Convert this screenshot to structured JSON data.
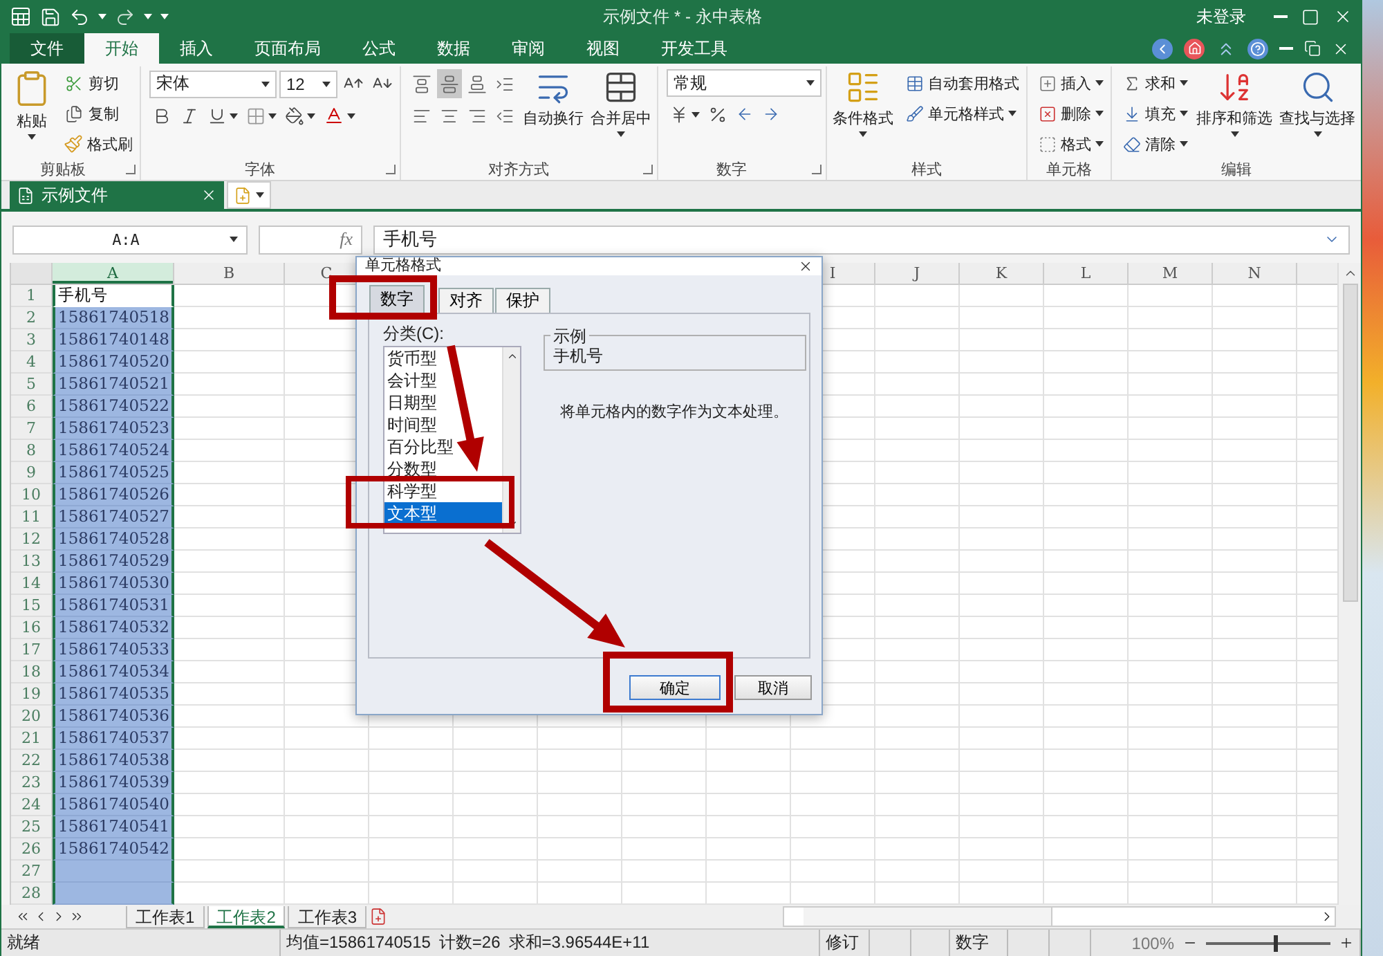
{
  "window": {
    "title": "示例文件 * - 永中表格",
    "user": "未登录"
  },
  "menu_tabs": [
    {
      "label": "文件",
      "kind": "file",
      "selected": false
    },
    {
      "label": "开始",
      "kind": "tab",
      "selected": true
    },
    {
      "label": "插入",
      "kind": "tab",
      "selected": false
    },
    {
      "label": "页面布局",
      "kind": "tab",
      "selected": false
    },
    {
      "label": "公式",
      "kind": "tab",
      "selected": false
    },
    {
      "label": "数据",
      "kind": "tab",
      "selected": false
    },
    {
      "label": "审阅",
      "kind": "tab",
      "selected": false
    },
    {
      "label": "视图",
      "kind": "tab",
      "selected": false
    },
    {
      "label": "开发工具",
      "kind": "tab",
      "selected": false
    }
  ],
  "ribbon": {
    "clipboard": {
      "paste": "粘贴",
      "cut": "剪切",
      "copy": "复制",
      "painter": "格式刷",
      "label": "剪贴板"
    },
    "font": {
      "name": "宋体",
      "size": "12",
      "label": "字体"
    },
    "alignment": {
      "buttons": [
        {
          "selected": false
        },
        {
          "selected": true
        },
        {
          "selected": false
        },
        {
          "selected": false
        },
        {
          "selected": false
        },
        {
          "selected": false
        },
        {
          "selected": false
        },
        {
          "selected": false
        }
      ],
      "wrap": "自动换行",
      "merge": "合并居中",
      "label": "对齐方式"
    },
    "number": {
      "format": "常规",
      "label": "数字"
    },
    "styles": {
      "conditional": "条件格式",
      "auto": "自动套用格式",
      "cell_styles": "单元格样式",
      "label": "样式"
    },
    "cells": {
      "insert": "插入",
      "delete": "删除",
      "format": "格式",
      "label": "单元格"
    },
    "editing": {
      "sum": "求和",
      "fill": "填充",
      "clear": "清除",
      "sort": "排序和筛选",
      "find": "查找与选择",
      "label": "编辑"
    }
  },
  "document_tab": {
    "title": "示例文件"
  },
  "formula_bar": {
    "name_box": "A:A",
    "fx": "fx",
    "content": "手机号"
  },
  "sheet": {
    "columns": [
      {
        "label": "A",
        "selected": true
      },
      {
        "label": "B",
        "selected": false
      },
      {
        "label": "C",
        "selected": false
      },
      {
        "label": "I",
        "selected": false
      },
      {
        "label": "J",
        "selected": false
      },
      {
        "label": "K",
        "selected": false
      },
      {
        "label": "L",
        "selected": false
      },
      {
        "label": "M",
        "selected": false
      },
      {
        "label": "N",
        "selected": false
      }
    ],
    "rows": [
      {
        "number": "1",
        "a": "手机号",
        "kind": "text",
        "active": true
      },
      {
        "number": "2",
        "a": "15861740518",
        "kind": "number",
        "active": false
      },
      {
        "number": "3",
        "a": "15861740148",
        "kind": "number",
        "active": false
      },
      {
        "number": "4",
        "a": "15861740520",
        "kind": "number",
        "active": false
      },
      {
        "number": "5",
        "a": "15861740521",
        "kind": "number",
        "active": false
      },
      {
        "number": "6",
        "a": "15861740522",
        "kind": "number",
        "active": false
      },
      {
        "number": "7",
        "a": "15861740523",
        "kind": "number",
        "active": false
      },
      {
        "number": "8",
        "a": "15861740524",
        "kind": "number",
        "active": false
      },
      {
        "number": "9",
        "a": "15861740525",
        "kind": "number",
        "active": false
      },
      {
        "number": "10",
        "a": "15861740526",
        "kind": "number",
        "active": false
      },
      {
        "number": "11",
        "a": "15861740527",
        "kind": "number",
        "active": false
      },
      {
        "number": "12",
        "a": "15861740528",
        "kind": "number",
        "active": false
      },
      {
        "number": "13",
        "a": "15861740529",
        "kind": "number",
        "active": false
      },
      {
        "number": "14",
        "a": "15861740530",
        "kind": "number",
        "active": false
      },
      {
        "number": "15",
        "a": "15861740531",
        "kind": "number",
        "active": false
      },
      {
        "number": "16",
        "a": "15861740532",
        "kind": "number",
        "active": false
      },
      {
        "number": "17",
        "a": "15861740533",
        "kind": "number",
        "active": false
      },
      {
        "number": "18",
        "a": "15861740534",
        "kind": "number",
        "active": false
      },
      {
        "number": "19",
        "a": "15861740535",
        "kind": "number",
        "active": false
      },
      {
        "number": "20",
        "a": "15861740536",
        "kind": "number",
        "active": false
      },
      {
        "number": "21",
        "a": "15861740537",
        "kind": "number",
        "active": false
      },
      {
        "number": "22",
        "a": "15861740538",
        "kind": "number",
        "active": false
      },
      {
        "number": "23",
        "a": "15861740539",
        "kind": "number",
        "active": false
      },
      {
        "number": "24",
        "a": "15861740540",
        "kind": "number",
        "active": false
      },
      {
        "number": "25",
        "a": "15861740541",
        "kind": "number",
        "active": false
      },
      {
        "number": "26",
        "a": "15861740542",
        "kind": "number",
        "active": false
      },
      {
        "number": "27",
        "kind": "empty",
        "active": false
      },
      {
        "number": "28",
        "kind": "empty",
        "active": false
      }
    ]
  },
  "dialog": {
    "title": "单元格格式",
    "tabs": [
      {
        "label": "数字",
        "selected": true
      },
      {
        "label": "对齐",
        "selected": false
      },
      {
        "label": "保护",
        "selected": false
      }
    ],
    "category_label": "分类(C):",
    "categories": [
      {
        "label": "货币型",
        "selected": false
      },
      {
        "label": "会计型",
        "selected": false
      },
      {
        "label": "日期型",
        "selected": false
      },
      {
        "label": "时间型",
        "selected": false
      },
      {
        "label": "百分比型",
        "selected": false
      },
      {
        "label": "分数型",
        "selected": false
      },
      {
        "label": "科学型",
        "selected": false
      },
      {
        "label": "文本型",
        "selected": true
      }
    ],
    "sample_label": "示例",
    "sample_value": "手机号",
    "description": "将单元格内的数字作为文本处理。",
    "buttons": [
      {
        "label": "确定",
        "kind": "default"
      },
      {
        "label": "取消",
        "kind": "normal"
      }
    ]
  },
  "sheet_tabs": [
    {
      "label": "工作表1",
      "selected": false
    },
    {
      "label": "工作表2",
      "selected": true
    },
    {
      "label": "工作表3",
      "selected": false
    }
  ],
  "status_bar": {
    "status": "就绪",
    "average": "均值=15861740515",
    "count": "计数=26",
    "sum": "求和=3.96544E+11",
    "track": "修订",
    "mode": "数字",
    "zoom": "100%",
    "zoom_slider": {
      "level": 0.55
    }
  }
}
